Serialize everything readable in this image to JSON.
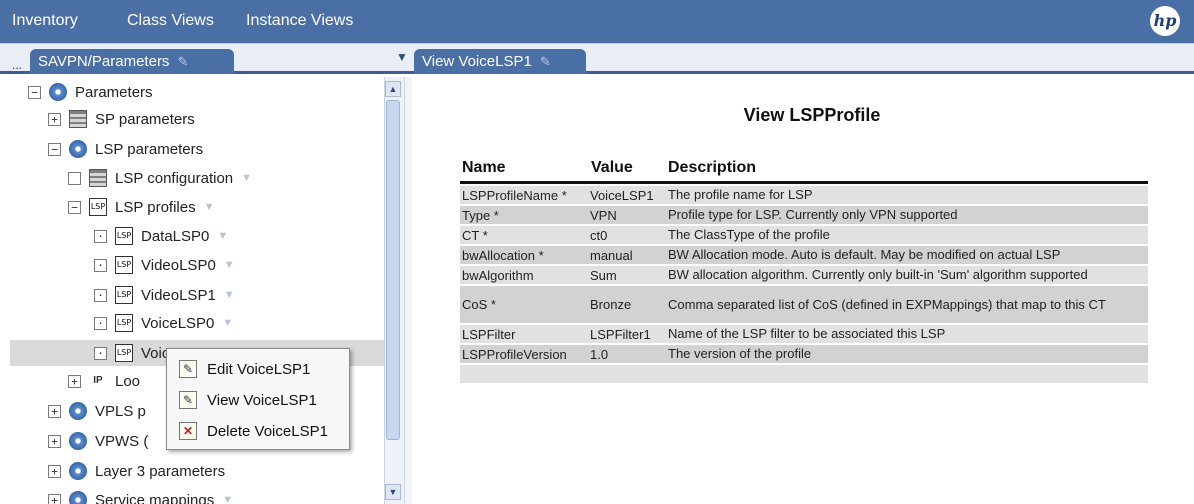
{
  "menubar": {
    "items": [
      "Inventory",
      "Class Views",
      "Instance Views"
    ],
    "logo": "hp"
  },
  "tabs": {
    "left": {
      "label": "SAVPN/Parameters",
      "dots": "..."
    },
    "right": {
      "label": "View VoiceLSP1"
    }
  },
  "tree": {
    "items": [
      {
        "label": "Parameters",
        "icon": "gear-icon",
        "toggle": "−"
      },
      {
        "label": "SP parameters",
        "icon": "table-icon",
        "toggle": "+"
      },
      {
        "label": "LSP parameters",
        "icon": "gear-icon",
        "toggle": "−"
      },
      {
        "label": "LSP configuration",
        "icon": "table-icon",
        "toggle": ""
      },
      {
        "label": "LSP profiles",
        "icon": "lsp-icon",
        "toggle": "−"
      },
      {
        "label": "DataLSP0",
        "icon": "lsp-icon",
        "toggle": "·"
      },
      {
        "label": "VideoLSP0",
        "icon": "lsp-icon",
        "toggle": "·"
      },
      {
        "label": "VideoLSP1",
        "icon": "lsp-icon",
        "toggle": "·"
      },
      {
        "label": "VoiceLSP0",
        "icon": "lsp-icon",
        "toggle": "·"
      },
      {
        "label": "VoiceLSP1",
        "icon": "lsp-icon",
        "toggle": "·"
      },
      {
        "label": "Loo",
        "icon": "ip-icon",
        "toggle": "+"
      },
      {
        "label": "VPLS p",
        "icon": "gear-icon",
        "toggle": "+"
      },
      {
        "label": "VPWS (",
        "icon": "gear-icon",
        "toggle": "+"
      },
      {
        "label": "Layer 3 parameters",
        "icon": "gear-icon",
        "toggle": "+"
      },
      {
        "label": "Service mappings",
        "icon": "gear-icon",
        "toggle": "+"
      }
    ],
    "lsp_icon_text": "LSP",
    "ip_icon_text": "IP"
  },
  "context_menu": {
    "items": [
      {
        "label": "Edit VoiceLSP1",
        "icon": "edit-icon"
      },
      {
        "label": "View VoiceLSP1",
        "icon": "view-icon"
      },
      {
        "label": "Delete VoiceLSP1",
        "icon": "delete-icon"
      }
    ]
  },
  "view": {
    "title": "View LSPProfile",
    "columns": [
      "Name",
      "Value",
      "Description"
    ],
    "rows": [
      {
        "name": "LSPProfileName *",
        "value": "VoiceLSP1",
        "description": "The profile name for LSP"
      },
      {
        "name": "Type *",
        "value": "VPN",
        "description": "Profile type for LSP. Currently only VPN supported"
      },
      {
        "name": "CT *",
        "value": "ct0",
        "description": "The ClassType of the profile"
      },
      {
        "name": "bwAllocation *",
        "value": "manual",
        "description": "BW Allocation mode. Auto is default. May be modified on actual LSP"
      },
      {
        "name": "bwAlgorithm",
        "value": "Sum",
        "description": "BW allocation algorithm. Currently only built-in 'Sum' algorithm supported"
      },
      {
        "name": "CoS *",
        "value": "Bronze",
        "description": "Comma separated list of CoS (defined in EXPMappings) that map to this CT"
      },
      {
        "name": "LSPFilter",
        "value": "LSPFilter1",
        "description": "Name of the LSP filter to be associated this LSP"
      },
      {
        "name": "LSPProfileVersion",
        "value": "1.0",
        "description": "The version of the profile"
      },
      {
        "name": "",
        "value": "",
        "description": ""
      }
    ]
  },
  "colors": {
    "menubar": "#4a6fa5",
    "tab": "#4a6fa5",
    "row_light": "#e1e1e1",
    "row_dark": "#d2d2d2"
  }
}
